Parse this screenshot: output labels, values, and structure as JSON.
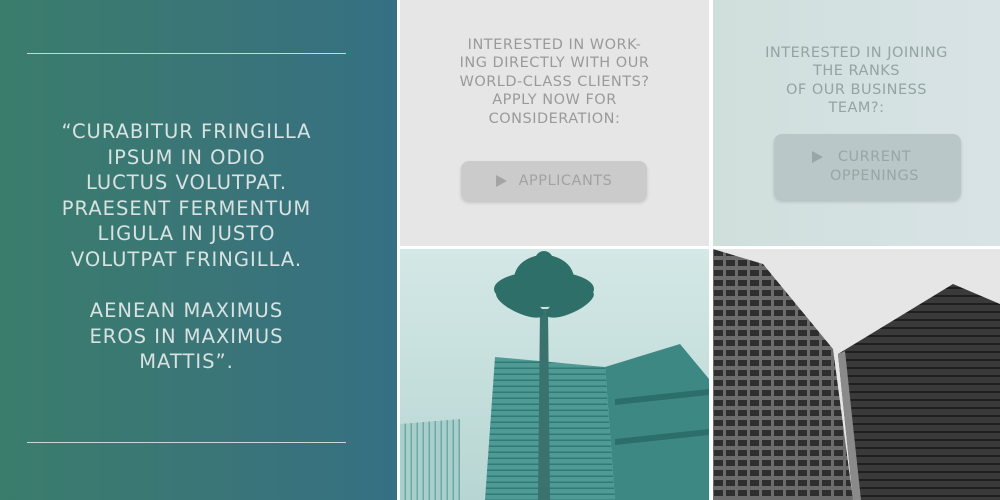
{
  "quote": {
    "text": "“CURABITUR FRINGILLA\nIPSUM IN ODIO\nLUCTUS VOLUTPAT.\nPRAESENT FERMENTUM\nLIGULA IN JUSTO\nVOLUTPAT FRINGILLA.\n\nAENEAN MAXIMUS\nEROS IN MAXIMUS\nMATTIS”."
  },
  "applicants": {
    "heading": "INTERESTED IN WORK-\nING DIRECTLY WITH OUR\nWORLD-CLASS CLIENTS?\nAPPLY NOW FOR\nCONSIDERATION:",
    "button_label": "APPLICANTS",
    "button_icon": "play-icon"
  },
  "team": {
    "heading": "INTERESTED IN JOINING\nTHE RANKS\nOF OUR BUSINESS\nTEAM?:",
    "button_label": "CURRENT\nOPPENINGS",
    "button_icon": "play-icon"
  },
  "colors": {
    "quote_panel_start": "#3a7d6c",
    "quote_panel_end": "#357083",
    "applicants_card_bg": "#e6e6e6",
    "team_card_bg": "#d3e1e0"
  }
}
